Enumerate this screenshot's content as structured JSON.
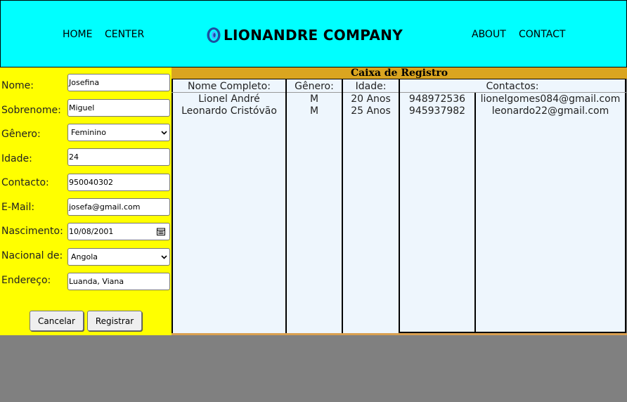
{
  "header": {
    "nav_left": [
      "HOME",
      "CENTER"
    ],
    "brand": "LIONANDRE COMPANY",
    "nav_right": [
      "ABOUT",
      "CONTACT"
    ],
    "logo_icon": "blue-ring-logo-icon",
    "background": "#00ffff"
  },
  "form": {
    "background": "#ffff00",
    "fields": [
      {
        "label": "Nome:",
        "value": "Josefina"
      },
      {
        "label": "Sobrenome:",
        "value": "Miguel"
      },
      {
        "label": "Gênero:",
        "value": "Feminino"
      },
      {
        "label": "Idade:",
        "value": "24"
      },
      {
        "label": "Contacto:",
        "value": "950040302"
      },
      {
        "label": "E-Mail:",
        "value": "josefa@gmail.com"
      },
      {
        "label": "Nascimento:",
        "value": "10/08/2001"
      },
      {
        "label": "Nacional de:",
        "value": "Angola"
      },
      {
        "label": "Endereço:",
        "value": "Luanda, Viana"
      }
    ],
    "cancel_label": "Cancelar",
    "register_label": "Registrar"
  },
  "registry": {
    "title": "Caixa de Registro",
    "title_bar_color": "#daa520",
    "headers": [
      "Nome Completo:",
      "Gênero:",
      "Idade:",
      "Contactos:"
    ],
    "rows": [
      {
        "name": "Lionel André",
        "gender": "M",
        "age": "20 Anos",
        "phone": "948972536",
        "email": "lionelgomes084@gmail.com"
      },
      {
        "name": "Leonardo Cristóvão",
        "gender": "M",
        "age": "25 Anos",
        "phone": "945937982",
        "email": "leonardo22@gmail.com"
      }
    ]
  }
}
